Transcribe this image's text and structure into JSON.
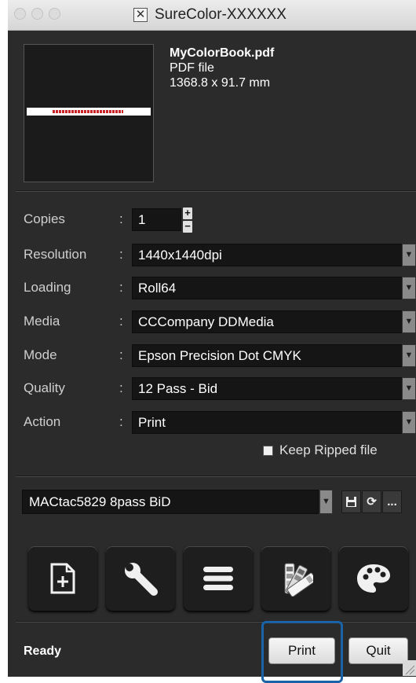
{
  "window": {
    "title": "SureColor-XXXXXX"
  },
  "file": {
    "name": "MyColorBook.pdf",
    "type": "PDF file",
    "size": "1368.8 x 91.7 mm"
  },
  "settings": {
    "copies": {
      "label": "Copies",
      "value": "1"
    },
    "resolution": {
      "label": "Resolution",
      "value": "1440x1440dpi"
    },
    "loading": {
      "label": "Loading",
      "value": "Roll64"
    },
    "media": {
      "label": "Media",
      "value": "CCCompany DDMedia"
    },
    "mode": {
      "label": "Mode",
      "value": "Epson Precision Dot CMYK"
    },
    "quality": {
      "label": "Quality",
      "value": "12 Pass - Bid"
    },
    "action": {
      "label": "Action",
      "value": "Print"
    },
    "colon": ":",
    "keep_ripped": {
      "label": "Keep Ripped file",
      "checked": false
    }
  },
  "preset": {
    "value": "MACtac5829 8pass BiD",
    "more": "..."
  },
  "toolbar": {
    "icons": [
      "add-page-icon",
      "wrench-icon",
      "list-icon",
      "color-swatch-icon",
      "palette-icon"
    ]
  },
  "footer": {
    "status": "Ready",
    "print": "Print",
    "quit": "Quit"
  },
  "colors": {
    "window_bg": "#2b2b2b",
    "field_bg": "#151515",
    "focus_ring": "#1b63a8"
  }
}
